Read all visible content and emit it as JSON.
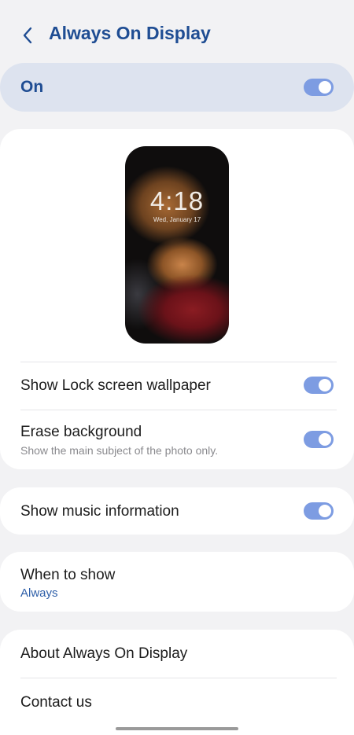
{
  "header": {
    "title": "Always On Display",
    "back_icon": "chevron-left-icon"
  },
  "master_switch": {
    "label": "On",
    "state": true
  },
  "preview": {
    "time": "4:18",
    "date": "Wed, January 17"
  },
  "settings": {
    "wallpaper": {
      "label": "Show Lock screen wallpaper",
      "state": true
    },
    "erase_bg": {
      "label": "Erase background",
      "subtitle": "Show the main subject of the photo only.",
      "state": true
    },
    "music": {
      "label": "Show music information",
      "state": true
    },
    "when_to_show": {
      "label": "When to show",
      "value": "Always"
    },
    "about": {
      "label": "About Always On Display"
    },
    "contact": {
      "label": "Contact us"
    }
  },
  "colors": {
    "accent": "#1f4d93",
    "toggle_on": "#7d9ce2",
    "master_bg": "#dde3ef",
    "page_bg": "#f2f2f4"
  }
}
